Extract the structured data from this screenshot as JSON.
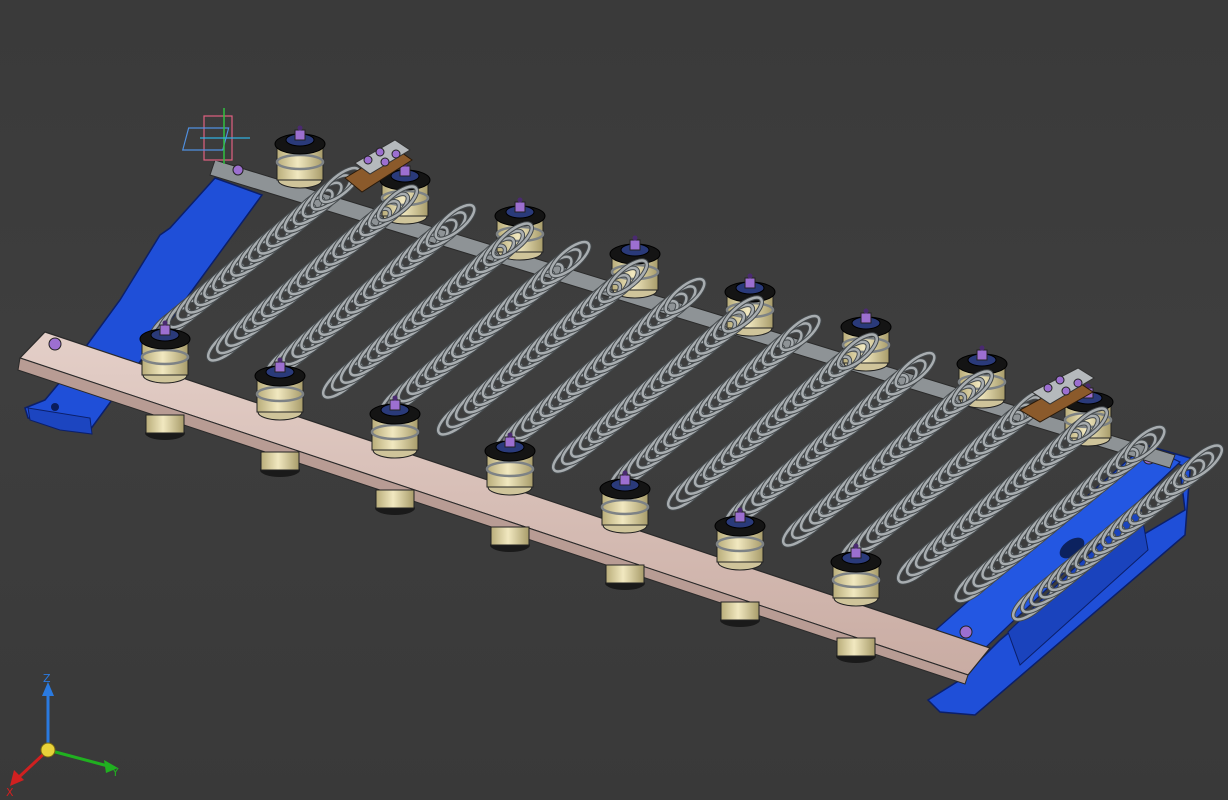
{
  "viewer": {
    "type": "cad-3d-viewport",
    "background_color": "#3c3c3c",
    "model": {
      "coil_count": 16,
      "insulator_count_front": 7,
      "insulator_count_back": 8,
      "colors": {
        "bracket": "#1f4fd8",
        "front_rail": "#d7bfb8",
        "coil": "#a8adb0",
        "insulator": "#e6dcae",
        "cap": "#141414",
        "bolt": "#9c6fd0",
        "terminal": "#8b5a2b",
        "frame": "#8e9396"
      }
    },
    "axis_triad": {
      "x_label": "X",
      "y_label": "Y",
      "z_label": "Z",
      "x_color": "#d02020",
      "y_color": "#20b020",
      "z_color": "#2a7ae0"
    },
    "origin_marker_icon": "coordinate-system-icon"
  }
}
